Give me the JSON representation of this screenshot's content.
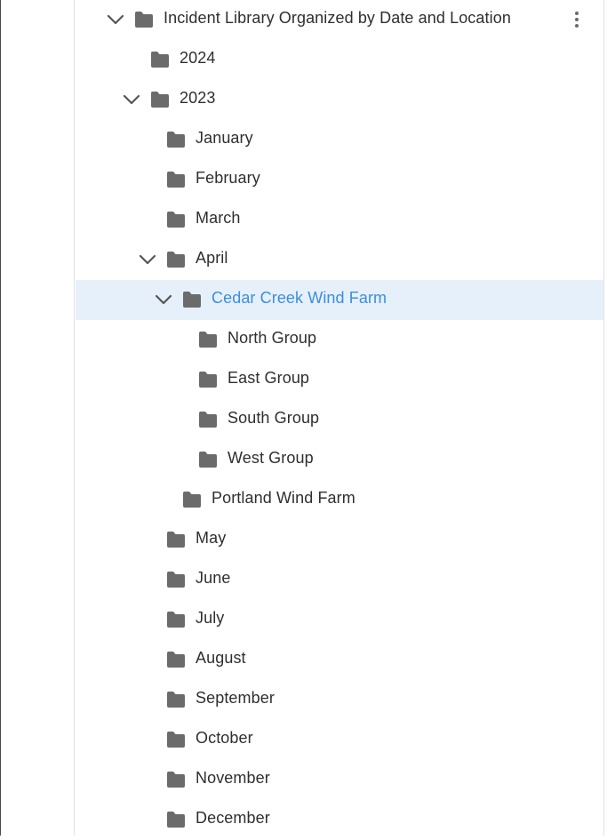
{
  "tree": {
    "root": {
      "label": "Incident Library Organized by Date and Location",
      "expanded": true
    },
    "year_2024": {
      "label": "2024"
    },
    "year_2023": {
      "label": "2023",
      "expanded": true
    },
    "months_before": [
      {
        "label": "January"
      },
      {
        "label": "February"
      },
      {
        "label": "March"
      }
    ],
    "april": {
      "label": "April",
      "expanded": true
    },
    "cedar_creek": {
      "label": "Cedar Creek Wind Farm",
      "expanded": true,
      "selected": true
    },
    "groups": [
      {
        "label": "North Group"
      },
      {
        "label": "East Group"
      },
      {
        "label": "South Group"
      },
      {
        "label": "West Group"
      }
    ],
    "portland": {
      "label": "Portland Wind Farm"
    },
    "months_after": [
      {
        "label": "May"
      },
      {
        "label": "June"
      },
      {
        "label": "July"
      },
      {
        "label": "August"
      },
      {
        "label": "September"
      },
      {
        "label": "October"
      },
      {
        "label": "November"
      },
      {
        "label": "December"
      }
    ]
  },
  "colors": {
    "folder": "#6b6b6b",
    "chevron": "#555555",
    "text": "#2f2f2f",
    "selected_bg": "#e6f0fb",
    "selected_text": "#3b8ee0"
  },
  "icons": {
    "chevron": "chevron-down-icon",
    "folder": "folder-icon",
    "more": "more-vertical-icon"
  }
}
